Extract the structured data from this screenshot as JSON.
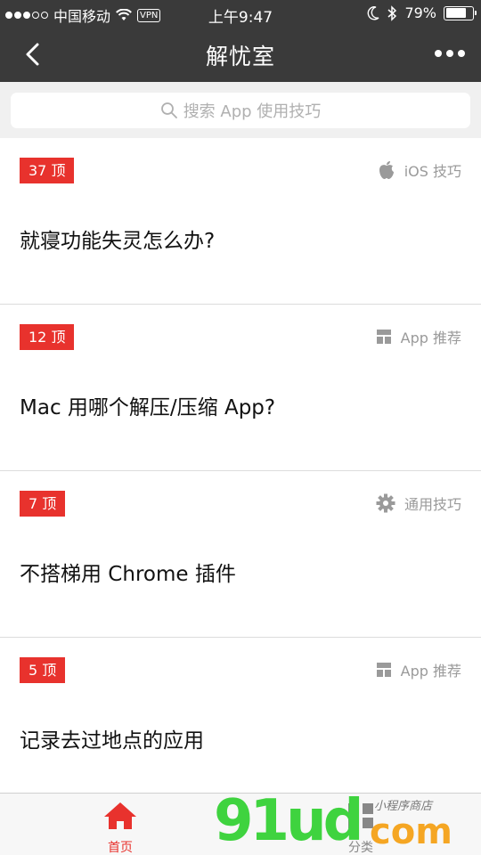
{
  "status": {
    "carrier": "中国移动",
    "vpn": "VPN",
    "time": "上午9:47",
    "battery": "79%",
    "battery_level": 0.79
  },
  "nav": {
    "title": "解忧室"
  },
  "search": {
    "placeholder": "搜索 App 使用技巧"
  },
  "items": [
    {
      "badge": "37 顶",
      "category": "iOS 技巧",
      "category_icon": "apple-icon",
      "title": "就寝功能失灵怎么办?"
    },
    {
      "badge": "12 顶",
      "category": "App 推荐",
      "category_icon": "grid-icon",
      "title": "Mac 用哪个解压/压缩 App?"
    },
    {
      "badge": "7 顶",
      "category": "通用技巧",
      "category_icon": "gear-icon",
      "title": "不搭梯用 Chrome 插件"
    },
    {
      "badge": "5 顶",
      "category": "App 推荐",
      "category_icon": "grid-icon",
      "title": "记录去过地点的应用"
    }
  ],
  "tabs": [
    {
      "label": "首页",
      "icon": "home-icon",
      "active": true
    },
    {
      "label": "分类",
      "icon": "grid-icon",
      "active": false
    }
  ],
  "watermark": {
    "big": "91ud",
    "com": "com",
    "small": "小程序商店"
  },
  "colors": {
    "bar": "#3a3a3a",
    "accent": "#e8322d",
    "muted": "#9a9a9a"
  }
}
